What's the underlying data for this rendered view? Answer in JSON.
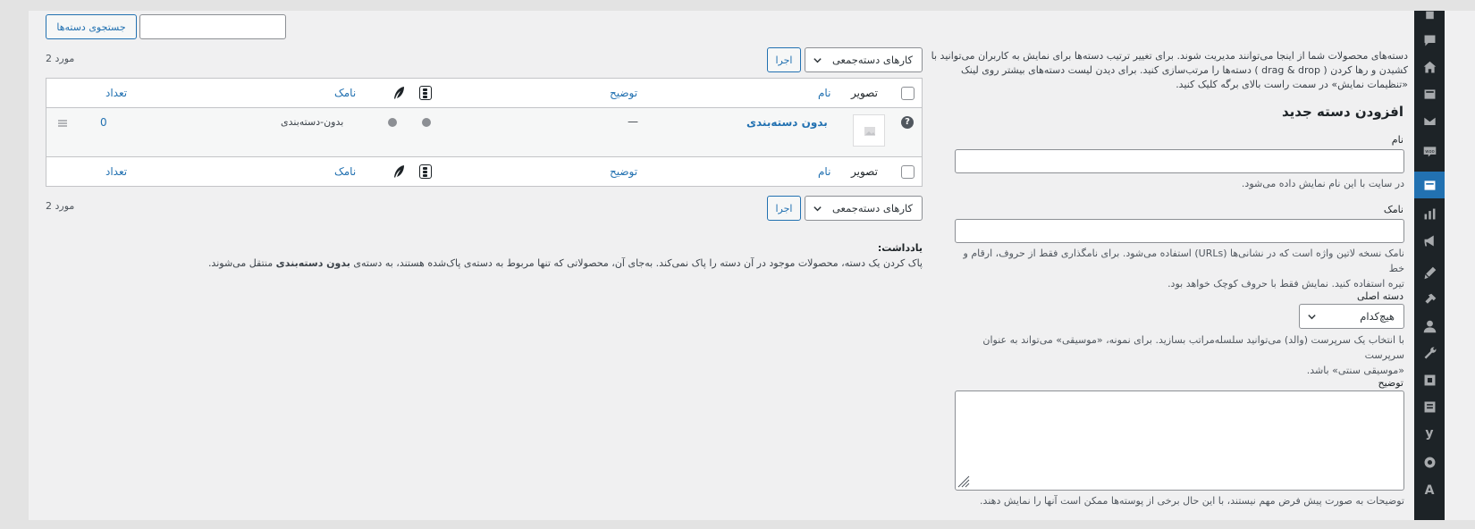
{
  "search": {
    "button": "جستجوی دسته‌ها",
    "value": ""
  },
  "intro": {
    "line1": "دسته‌های محصولات شما از اینجا می‌توانند مدیریت شوند. برای تغییر ترتیب دسته‌ها برای نمایش به کاربران می‌توانید با",
    "line2": "کشیدن و رها کردن ( drag & drop ) دسته‌ها را مرتب‌سازی کنید. برای دیدن لیست دسته‌های بیشتر روی لینک",
    "line3": "«تنظیمات نمایش» در سمت راست بالای برگه کلیک کنید."
  },
  "form": {
    "title": "افزودن دسته جدید",
    "name_label": "نام",
    "name_help": "در سایت با این نام نمایش داده می‌شود.",
    "slug_label": "نامک",
    "slug_help1": "نامک نسخه لاتین واژه است که در نشانی‌ها (URLs) استفاده می‌شود. برای نامگذاری فقط از حروف، ارقام و خط",
    "slug_help2": "تیره استفاده کنید. نمایش فقط با حروف کوچک خواهد بود.",
    "parent_label": "دسته اصلی",
    "parent_value": "هیچ‌کدام",
    "parent_help1": "با انتخاب یک سرپرست (والد) می‌توانید سلسله‌مراتب بسازید. برای نمونه، «موسیقی» می‌تواند به عنوان سرپرست",
    "parent_help2": "«موسیقی سنتی» باشد.",
    "desc_label": "توضیح",
    "desc_help": "توضیحات به صورت پیش فرض مهم نیستند، با این حال برخی از پوسته‌ها ممکن است آنها را نمایش دهند."
  },
  "bulk": {
    "label": "کارهای دسته‌جمعی",
    "apply": "اجرا",
    "count": "2 مورد"
  },
  "table": {
    "columns": {
      "image": "تصویر",
      "name": "نام",
      "description": "توضیح",
      "slug": "نامک",
      "count": "تعداد"
    },
    "rows": [
      {
        "name": "بدون دسته‌بندی",
        "description": "—",
        "slug": "بدون-دسته‌بندی",
        "count": "0"
      }
    ]
  },
  "note": {
    "title": "یادداشت:",
    "text_before": "پاک کردن یک دسته، محصولات موجود در آن دسته را پاک نمی‌کند. به‌جای آن، محصولاتی که تنها مربوط به دسته‌ی پاک‌شده هستند، به دسته‌ی",
    "bold": "بدون دسته‌بندی",
    "text_after": "منتقل می‌شوند."
  },
  "sidebar_icons": [
    "posts-icon",
    "comments-icon",
    "home-icon",
    "media-icon",
    "mail-icon",
    "woocommerce-icon",
    "products-icon",
    "analytics-icon",
    "marketing-icon",
    "appearance-icon",
    "plugins-icon",
    "users-icon",
    "tools-icon",
    "settings-icon",
    "seo-icon",
    "yoast-icon",
    "gear-icon",
    "font-icon"
  ],
  "colors": {
    "accent": "#2271b1",
    "adminbar": "#1d2327"
  }
}
